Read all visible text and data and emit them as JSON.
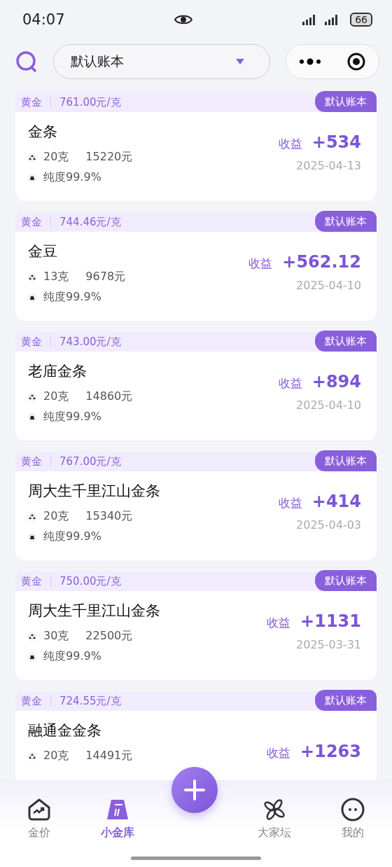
{
  "status_bar": {
    "time": "04:07",
    "battery": "66"
  },
  "header": {
    "account_selector": "默认账本"
  },
  "holdings": [
    {
      "category": "黄金",
      "price": "761.00元/克",
      "tag": "默认账本",
      "name": "金条",
      "weight": "20克",
      "amount": "15220元",
      "purity": "纯度99.9%",
      "profit_label": "收益",
      "profit": "+534",
      "date": "2025-04-13"
    },
    {
      "category": "黄金",
      "price": "744.46元/克",
      "tag": "默认账本",
      "name": "金豆",
      "weight": "13克",
      "amount": "9678元",
      "purity": "纯度99.9%",
      "profit_label": "收益",
      "profit": "+562.12",
      "date": "2025-04-10"
    },
    {
      "category": "黄金",
      "price": "743.00元/克",
      "tag": "默认账本",
      "name": "老庙金条",
      "weight": "20克",
      "amount": "14860元",
      "purity": "纯度99.9%",
      "profit_label": "收益",
      "profit": "+894",
      "date": "2025-04-10"
    },
    {
      "category": "黄金",
      "price": "767.00元/克",
      "tag": "默认账本",
      "name": "周大生千里江山金条",
      "weight": "20克",
      "amount": "15340元",
      "purity": "纯度99.9%",
      "profit_label": "收益",
      "profit": "+414",
      "date": "2025-04-03"
    },
    {
      "category": "黄金",
      "price": "750.00元/克",
      "tag": "默认账本",
      "name": "周大生千里江山金条",
      "weight": "30克",
      "amount": "22500元",
      "purity": "纯度99.9%",
      "profit_label": "收益",
      "profit": "+1131",
      "date": "2025-03-31"
    },
    {
      "category": "黄金",
      "price": "724.55元/克",
      "tag": "默认账本",
      "name": "融通金金条",
      "weight": "20克",
      "amount": "14491元",
      "profit_label": "收益",
      "profit": "+1263"
    }
  ],
  "nav": [
    {
      "label": "金价",
      "selected": false,
      "kind": "chart"
    },
    {
      "label": "小金库",
      "selected": true,
      "kind": "vault"
    },
    {
      "label": "大家坛",
      "selected": false,
      "kind": "forum"
    },
    {
      "label": "我的",
      "selected": false,
      "kind": "me"
    }
  ]
}
